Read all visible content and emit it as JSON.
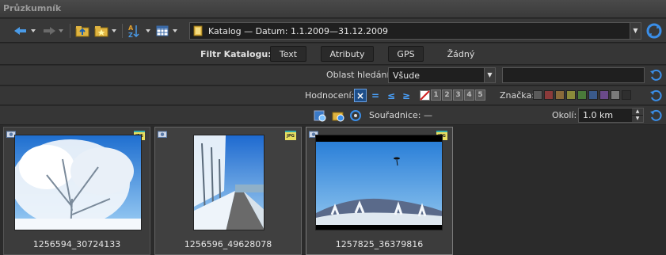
{
  "window": {
    "title": "Průzkumník"
  },
  "toolbar": {
    "address": "Katalog — Datum: 1.1.2009—31.12.2009",
    "icons": [
      "back-arrow-icon",
      "forward-arrow-icon",
      "folder-up-icon",
      "favorite-folder-icon",
      "sort-az-icon",
      "view-grid-icon",
      "refresh-icon"
    ]
  },
  "filter": {
    "label": "Filtr Katalogu:",
    "buttons": [
      "Text",
      "Atributy",
      "GPS",
      "Žádný"
    ]
  },
  "search_area": {
    "label": "Oblast hledání:",
    "selected": "Všude",
    "query": ""
  },
  "rating": {
    "label": "Hodnocení:",
    "operators": [
      "×",
      "=",
      "≤",
      "≥"
    ],
    "stars": [
      "1",
      "2",
      "3",
      "4",
      "5"
    ],
    "mark_label": "Značka:",
    "mark_colors": [
      "#5a5a5a",
      "#8b3a3a",
      "#8a6a3a",
      "#8a8a3a",
      "#4a7a3a",
      "#3a5a8a",
      "#6a4a8a",
      "#7a7a7a",
      "#2f2f2f"
    ]
  },
  "geo": {
    "coord_label": "Souřadnice: —",
    "okoli_label": "Okolí:",
    "okoli_value": "1.0 km"
  },
  "thumbnails": [
    {
      "caption": "1256594_30724133",
      "badge": "JPG"
    },
    {
      "caption": "1256596_49628078",
      "badge": "JPG"
    },
    {
      "caption": "1257825_36379816",
      "badge": "JPG"
    }
  ],
  "colors": {
    "accent": "#4aa3ff",
    "selected": "#1e4f8a"
  }
}
